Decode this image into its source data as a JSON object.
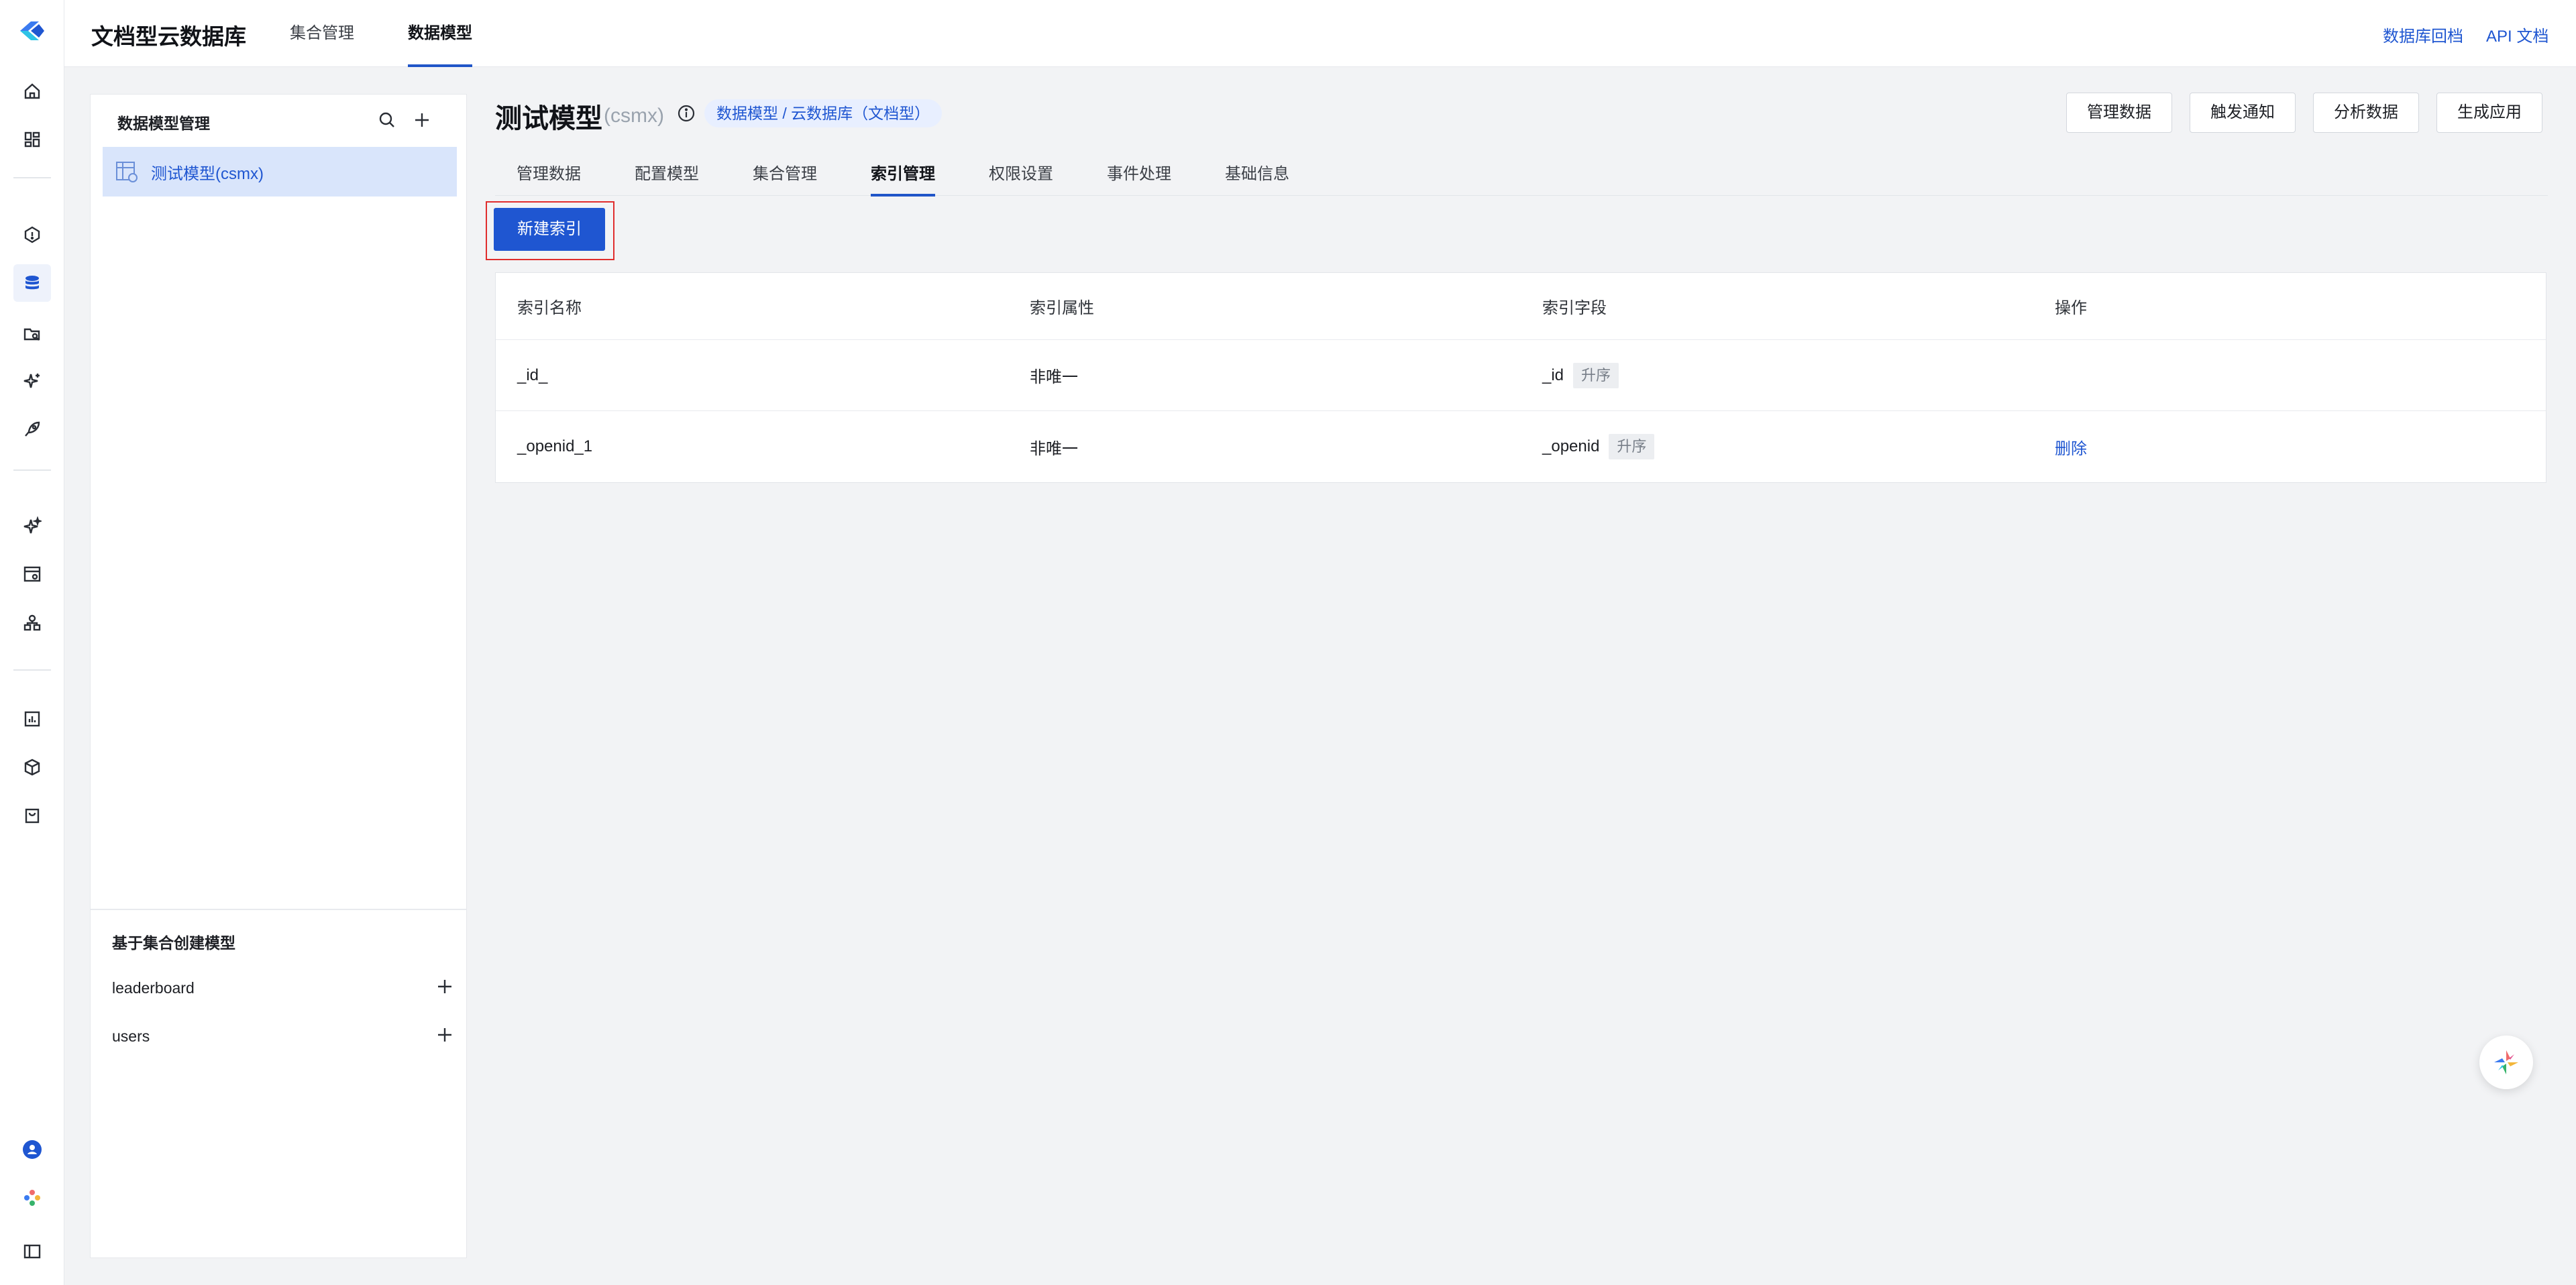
{
  "header": {
    "app_title": "文档型云数据库",
    "nav": [
      {
        "label": "集合管理",
        "active": false
      },
      {
        "label": "数据模型",
        "active": true
      }
    ],
    "links": {
      "rollback": "数据库回档",
      "api_docs": "API 文档"
    }
  },
  "rail": {
    "icons": [
      "home-icon",
      "dashboard-icon",
      "hexagon-icon",
      "database-icon",
      "folder-search-icon",
      "sparkle-icon",
      "rocket-icon",
      "ai-sparkle-icon",
      "browser-icon",
      "user-network-icon",
      "chart-icon",
      "cube-icon",
      "shopping-bag-icon",
      "user-avatar-icon",
      "flower-icon",
      "sidebar-toggle-icon"
    ],
    "active": "database-icon"
  },
  "sidebar": {
    "title": "数据模型管理",
    "models": [
      {
        "label": "测试模型(csmx)",
        "selected": true
      }
    ],
    "collections_title": "基于集合创建模型",
    "collections": [
      {
        "label": "leaderboard"
      },
      {
        "label": "users"
      }
    ]
  },
  "page": {
    "title": "测试模型",
    "subtitle": "(csmx)",
    "breadcrumb": "数据模型 / 云数据库（文档型）",
    "actions": [
      "管理数据",
      "触发通知",
      "分析数据",
      "生成应用"
    ],
    "tabs": [
      {
        "label": "管理数据",
        "active": false
      },
      {
        "label": "配置模型",
        "active": false
      },
      {
        "label": "集合管理",
        "active": false
      },
      {
        "label": "索引管理",
        "active": true
      },
      {
        "label": "权限设置",
        "active": false
      },
      {
        "label": "事件处理",
        "active": false
      },
      {
        "label": "基础信息",
        "active": false
      }
    ],
    "new_index_button": "新建索引"
  },
  "table": {
    "columns": [
      "索引名称",
      "索引属性",
      "索引字段",
      "操作"
    ],
    "rows": [
      {
        "name": "_id_",
        "attr": "非唯一",
        "field": "_id",
        "order": "升序",
        "action": ""
      },
      {
        "name": "_openid_1",
        "attr": "非唯一",
        "field": "_openid",
        "order": "升序",
        "action": "删除"
      }
    ]
  },
  "colors": {
    "accent": "#1f56d1",
    "highlight": "#e02d2d",
    "selected_bg": "#d9e5fb"
  }
}
